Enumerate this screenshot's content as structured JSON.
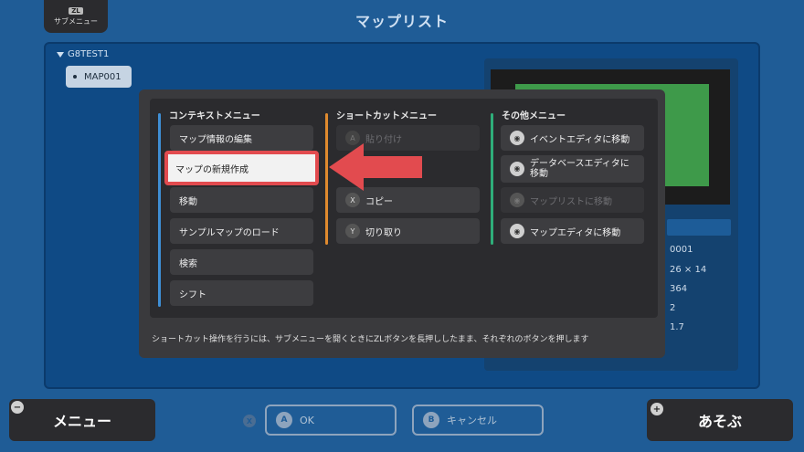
{
  "header": {
    "title": "マップリスト"
  },
  "submenu": {
    "badge": "ZL",
    "label": "サブメニュー"
  },
  "tree": {
    "root": "G8TEST1",
    "items": [
      {
        "label": "MAP001"
      }
    ]
  },
  "info": {
    "values": [
      "0001",
      "26 × 14",
      "364",
      "2",
      "1.7"
    ]
  },
  "context_menu": {
    "columns": [
      {
        "header": "コンテキストメニュー",
        "accent": "#3f8fd6",
        "items": [
          {
            "label": "マップ情報の編集",
            "state": "normal"
          },
          {
            "label": "マップの新規作成",
            "state": "selected"
          },
          {
            "label": "移動",
            "state": "normal"
          },
          {
            "label": "サンプルマップのロード",
            "state": "normal"
          },
          {
            "label": "検索",
            "state": "normal"
          },
          {
            "label": "シフト",
            "state": "normal"
          }
        ]
      },
      {
        "header": "ショートカットメニュー",
        "accent": "#e08a2e",
        "items": [
          {
            "key": "A",
            "label": "貼り付け",
            "state": "disabled"
          },
          {
            "key": "X",
            "label": "コピー",
            "state": "normal"
          },
          {
            "key": "Y",
            "label": "切り取り",
            "state": "normal"
          }
        ]
      },
      {
        "header": "その他メニュー",
        "accent": "#2fae7a",
        "items": [
          {
            "icon": "event-editor-icon",
            "label": "イベントエディタに移動",
            "state": "normal"
          },
          {
            "icon": "database-editor-icon",
            "label": "データベースエディタに移動",
            "state": "normal"
          },
          {
            "icon": "map-list-icon",
            "label": "マップリストに移動",
            "state": "disabled"
          },
          {
            "icon": "map-editor-icon",
            "label": "マップエディタに移動",
            "state": "normal"
          }
        ]
      }
    ],
    "hint": "ショートカット操作を行うには、サブメニューを開くときにZLボタンを長押ししたまま、それぞれのボタンを押します"
  },
  "bottom": {
    "menu_badge": "−",
    "menu_label": "メニュー",
    "x_badge": "X",
    "ok_badge": "A",
    "ok_label": "OK",
    "cancel_badge": "B",
    "cancel_label": "キャンセル",
    "play_badge": "+",
    "play_label": "あそぶ"
  },
  "colors": {
    "background": "#1f5c96",
    "selection_border": "#e24b4f",
    "arrow": "#e24b4f",
    "preview_green": "#3e9a4a"
  }
}
